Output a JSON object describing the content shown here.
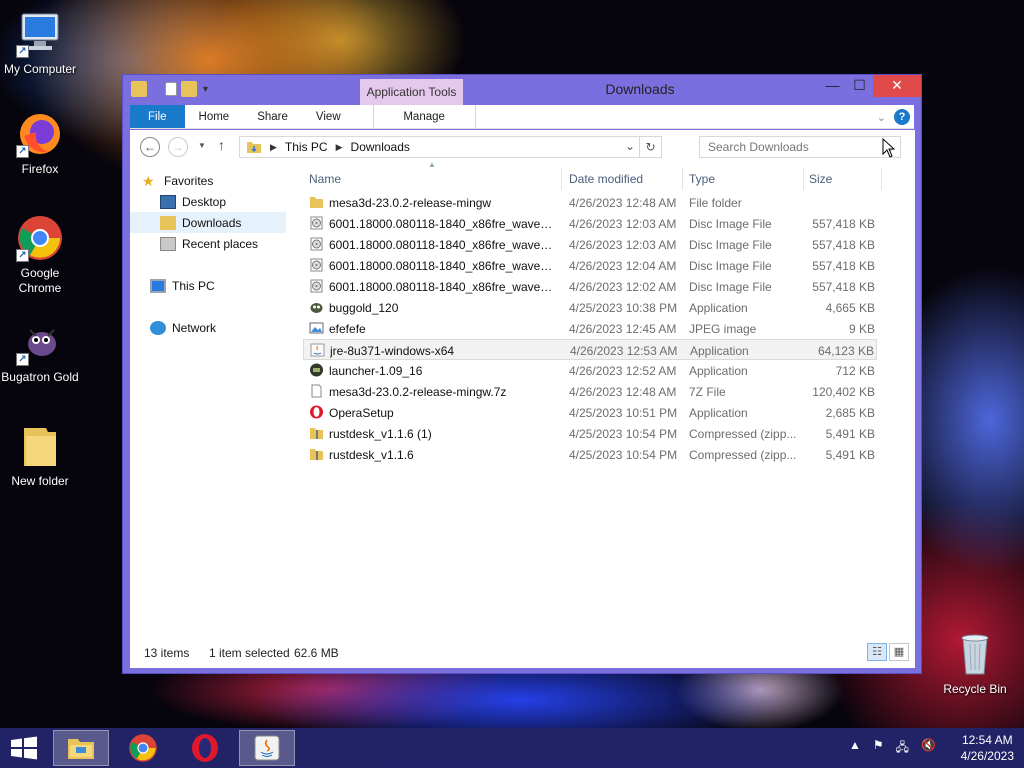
{
  "desktop": {
    "icons": [
      {
        "label": "My Computer"
      },
      {
        "label": "Firefox"
      },
      {
        "label": "Google Chrome"
      },
      {
        "label": "Bugatron Gold"
      },
      {
        "label": "New folder"
      },
      {
        "label": "Recycle Bin"
      }
    ]
  },
  "window": {
    "title": "Downloads",
    "context_tab": "Application Tools",
    "tabs": {
      "file": "File",
      "home": "Home",
      "share": "Share",
      "view": "View",
      "manage": "Manage"
    },
    "close_glyph": "✕",
    "min_glyph": "—",
    "max_glyph": "☐"
  },
  "address": {
    "segments": [
      "This PC",
      "Downloads"
    ],
    "search_placeholder": "Search Downloads"
  },
  "navpane": {
    "favorites": "Favorites",
    "desktop": "Desktop",
    "downloads": "Downloads",
    "recent": "Recent places",
    "thispc": "This PC",
    "network": "Network"
  },
  "columns": {
    "name": "Name",
    "date": "Date modified",
    "type": "Type",
    "size": "Size"
  },
  "files": [
    {
      "name": "mesa3d-23.0.2-release-mingw",
      "date": "4/26/2023 12:48 AM",
      "type": "File folder",
      "size": "",
      "icon": "folder-icon"
    },
    {
      "name": "6001.18000.080118-1840_x86fre_wave1_Se...",
      "date": "4/26/2023 12:03 AM",
      "type": "Disc Image File",
      "size": "557,418 KB",
      "icon": "disc-image-icon"
    },
    {
      "name": "6001.18000.080118-1840_x86fre_wave1_Se...",
      "date": "4/26/2023 12:03 AM",
      "type": "Disc Image File",
      "size": "557,418 KB",
      "icon": "disc-image-icon"
    },
    {
      "name": "6001.18000.080118-1840_x86fre_wave1_Se...",
      "date": "4/26/2023 12:04 AM",
      "type": "Disc Image File",
      "size": "557,418 KB",
      "icon": "disc-image-icon"
    },
    {
      "name": "6001.18000.080118-1840_x86fre_wave1_Se...",
      "date": "4/26/2023 12:02 AM",
      "type": "Disc Image File",
      "size": "557,418 KB",
      "icon": "disc-image-icon"
    },
    {
      "name": "buggold_120",
      "date": "4/25/2023 10:38 PM",
      "type": "Application",
      "size": "4,665 KB",
      "icon": "bug-app-icon"
    },
    {
      "name": "efefefe",
      "date": "4/26/2023 12:45 AM",
      "type": "JPEG image",
      "size": "9 KB",
      "icon": "image-icon"
    },
    {
      "name": "jre-8u371-windows-x64",
      "date": "4/26/2023 12:53 AM",
      "type": "Application",
      "size": "64,123 KB",
      "icon": "java-icon"
    },
    {
      "name": "launcher-1.09_16",
      "date": "4/26/2023 12:52 AM",
      "type": "Application",
      "size": "712 KB",
      "icon": "launcher-icon"
    },
    {
      "name": "mesa3d-23.0.2-release-mingw.7z",
      "date": "4/26/2023 12:48 AM",
      "type": "7Z File",
      "size": "120,402 KB",
      "icon": "document-icon"
    },
    {
      "name": "OperaSetup",
      "date": "4/25/2023 10:51 PM",
      "type": "Application",
      "size": "2,685 KB",
      "icon": "opera-icon"
    },
    {
      "name": "rustdesk_v1.1.6 (1)",
      "date": "4/25/2023 10:54 PM",
      "type": "Compressed (zipp...",
      "size": "5,491 KB",
      "icon": "zip-folder-icon"
    },
    {
      "name": "rustdesk_v1.1.6",
      "date": "4/25/2023 10:54 PM",
      "type": "Compressed (zipp...",
      "size": "5,491 KB",
      "icon": "zip-folder-icon"
    }
  ],
  "status": {
    "item_count": "13 items",
    "selection": "1 item selected",
    "selection_size": "62.6 MB"
  },
  "taskbar": {
    "time": "12:54 AM",
    "date": "4/26/2023"
  },
  "colors": {
    "window_frame": "#7b6fe0",
    "file_tab": "#1979ca",
    "context_tab": "#e5c8ec",
    "close_button": "#e04a4a"
  }
}
